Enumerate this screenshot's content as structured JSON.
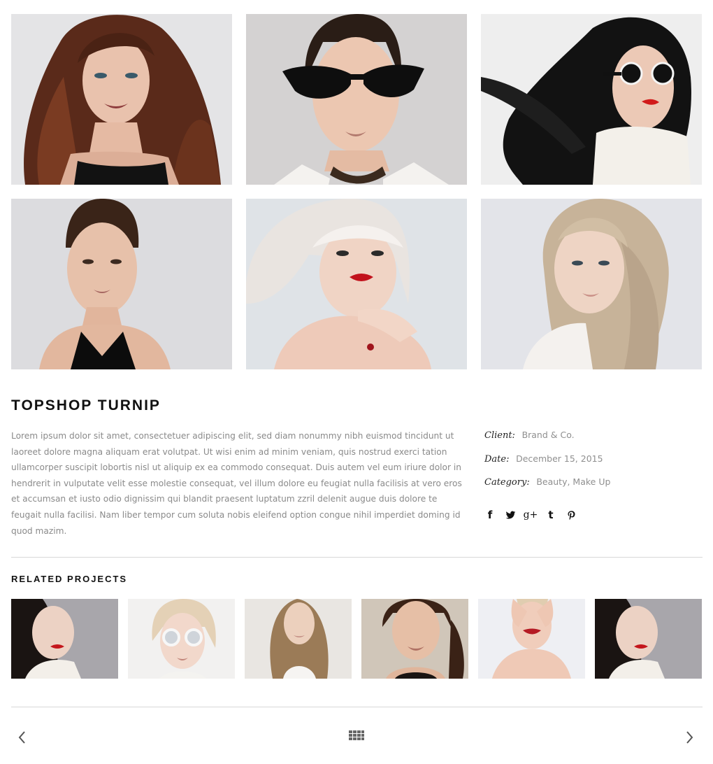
{
  "gallery": {
    "rows": [
      [
        {
          "name": "gallery-photo-curly-auburn-hair"
        },
        {
          "name": "gallery-photo-cat-eye-sunglasses"
        },
        {
          "name": "gallery-photo-round-sunglasses"
        }
      ],
      [
        {
          "name": "gallery-photo-slicked-hair"
        },
        {
          "name": "gallery-photo-platinum-bob"
        },
        {
          "name": "gallery-photo-wavy-blonde"
        }
      ]
    ]
  },
  "project": {
    "title": "TOPSHOP TURNIP",
    "description": "Lorem ipsum dolor sit amet, consectetuer adipiscing elit, sed diam nonummy nibh euismod tincidunt ut laoreet dolore magna aliquam erat volutpat. Ut wisi enim ad minim veniam, quis nostrud exerci tation ullamcorper suscipit lobortis nisl ut aliquip ex ea commodo consequat. Duis autem vel eum iriure dolor in hendrerit in vulputate velit esse molestie consequat, vel illum dolore eu feugiat nulla facilisis at vero eros et accumsan et iusto odio dignissim qui blandit praesent luptatum zzril delenit augue duis dolore te feugait nulla facilisi. Nam liber tempor cum soluta nobis eleifend option congue nihil imperdiet doming id quod mazim.",
    "meta": {
      "client_label": "Client:",
      "client_value": "Brand & Co.",
      "date_label": "Date:",
      "date_value": "December 15, 2015",
      "category_label": "Category:",
      "category_value": "Beauty, Make Up"
    },
    "social": {
      "facebook": "f",
      "gplus": "g+",
      "tumblr": "t"
    }
  },
  "related": {
    "title": "RELATED PROJECTS"
  },
  "colors": {
    "text_dark": "#111111",
    "text_muted": "#8a8a8a",
    "divider": "#d8d8d8"
  },
  "icons": {
    "prev": "chevron-left-icon",
    "grid": "grid-icon",
    "next": "chevron-right-icon"
  }
}
